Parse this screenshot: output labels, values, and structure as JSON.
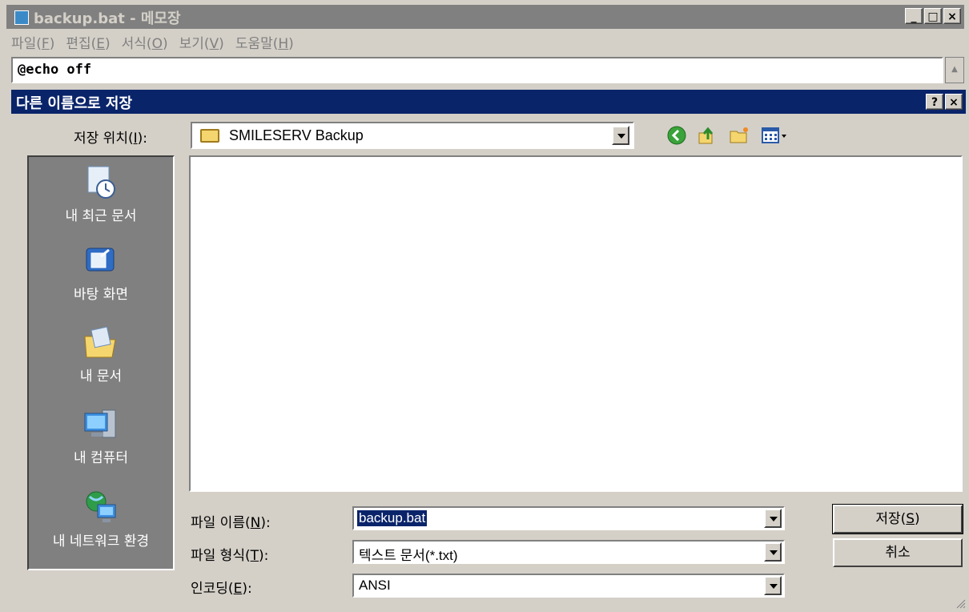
{
  "notepad": {
    "title": "backup.bat - 메모장",
    "menu": [
      {
        "label": "파일(",
        "key": "F",
        "end": ")"
      },
      {
        "label": "편집(",
        "key": "E",
        "end": ")"
      },
      {
        "label": "서식(",
        "key": "O",
        "end": ")"
      },
      {
        "label": "보기(",
        "key": "V",
        "end": ")"
      },
      {
        "label": "도움말(",
        "key": "H",
        "end": ")"
      }
    ],
    "content": "@echo off"
  },
  "dialog": {
    "title": "다른 이름으로 저장",
    "help_glyph": "?",
    "close_glyph": "×",
    "save_in_label_pre": "저장 위치(",
    "save_in_label_key": "I",
    "save_in_label_post": "):",
    "save_in_value": "SMILESERV Backup",
    "places": [
      {
        "label": "내 최근 문서",
        "icon": "recent-documents-icon"
      },
      {
        "label": "바탕 화면",
        "icon": "desktop-icon"
      },
      {
        "label": "내 문서",
        "icon": "my-documents-icon"
      },
      {
        "label": "내 컴퓨터",
        "icon": "my-computer-icon"
      },
      {
        "label": "내 네트워크 환경",
        "icon": "network-places-icon"
      }
    ],
    "filename_label_pre": "파일 이름(",
    "filename_label_key": "N",
    "filename_label_post": "):",
    "filename_value": "backup.bat",
    "filetype_label_pre": "파일 형식(",
    "filetype_label_key": "T",
    "filetype_label_post": "):",
    "filetype_value": "텍스트 문서(*.txt)",
    "encoding_label_pre": "인코딩(",
    "encoding_label_key": "E",
    "encoding_label_post": "):",
    "encoding_value": "ANSI",
    "save_button_pre": "저장(",
    "save_button_key": "S",
    "save_button_post": ")",
    "cancel_button": "취소"
  },
  "colors": {
    "active_title": "#0a246a",
    "inactive_title": "#808080",
    "face": "#d4d0c8",
    "places_bar": "#808080"
  }
}
